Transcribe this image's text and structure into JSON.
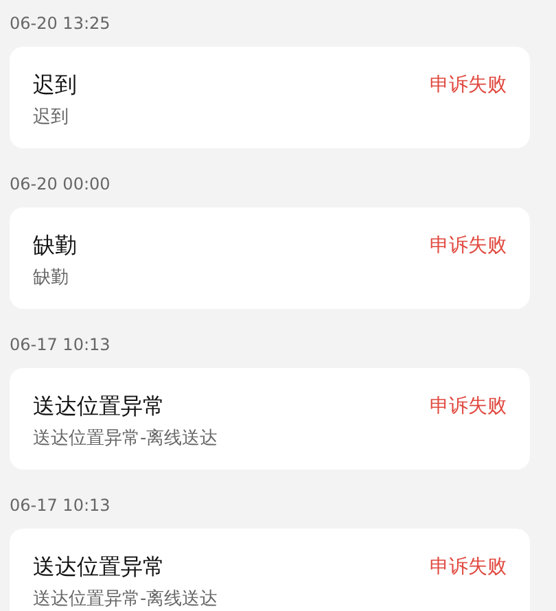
{
  "records": [
    {
      "time": "06-20 13:25",
      "title": "迟到",
      "detail": "迟到",
      "status": "申诉失败"
    },
    {
      "time": "06-20 00:00",
      "title": "缺勤",
      "detail": "缺勤",
      "status": "申诉失败"
    },
    {
      "time": "06-17 10:13",
      "title": "送达位置异常",
      "detail": "送达位置异常-离线送达",
      "status": "申诉失败"
    },
    {
      "time": "06-17 10:13",
      "title": "送达位置异常",
      "detail": "送达位置异常-离线送达",
      "status": "申诉失败"
    }
  ]
}
